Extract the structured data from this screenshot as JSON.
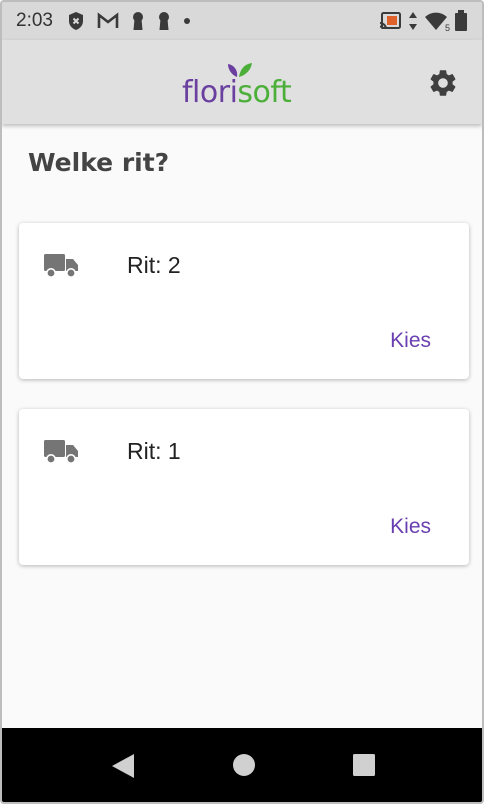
{
  "status_bar": {
    "time": "2:03",
    "icons_left": [
      "shield-icon",
      "gmail-icon",
      "keyhole-icon",
      "keyhole-icon",
      "dot-icon"
    ],
    "icons_right": [
      "cast-icon",
      "data-arrows-icon",
      "wifi-icon",
      "battery-icon"
    ],
    "wifi_badge": "5"
  },
  "app_bar": {
    "logo_text_1": "flori",
    "logo_text_2": "soft",
    "brand_purple": "#6a3fa0",
    "brand_green": "#4caf3a",
    "settings_icon": "gear-icon"
  },
  "main": {
    "title": "Welke rit?",
    "rides": [
      {
        "label": "Rit: 2",
        "action": "Kies",
        "icon": "truck-icon"
      },
      {
        "label": "Rit: 1",
        "action": "Kies",
        "icon": "truck-icon"
      }
    ],
    "accent_color": "#6a3fb0"
  },
  "nav_bar": {
    "buttons": [
      "back-icon",
      "home-icon",
      "recents-icon"
    ]
  }
}
